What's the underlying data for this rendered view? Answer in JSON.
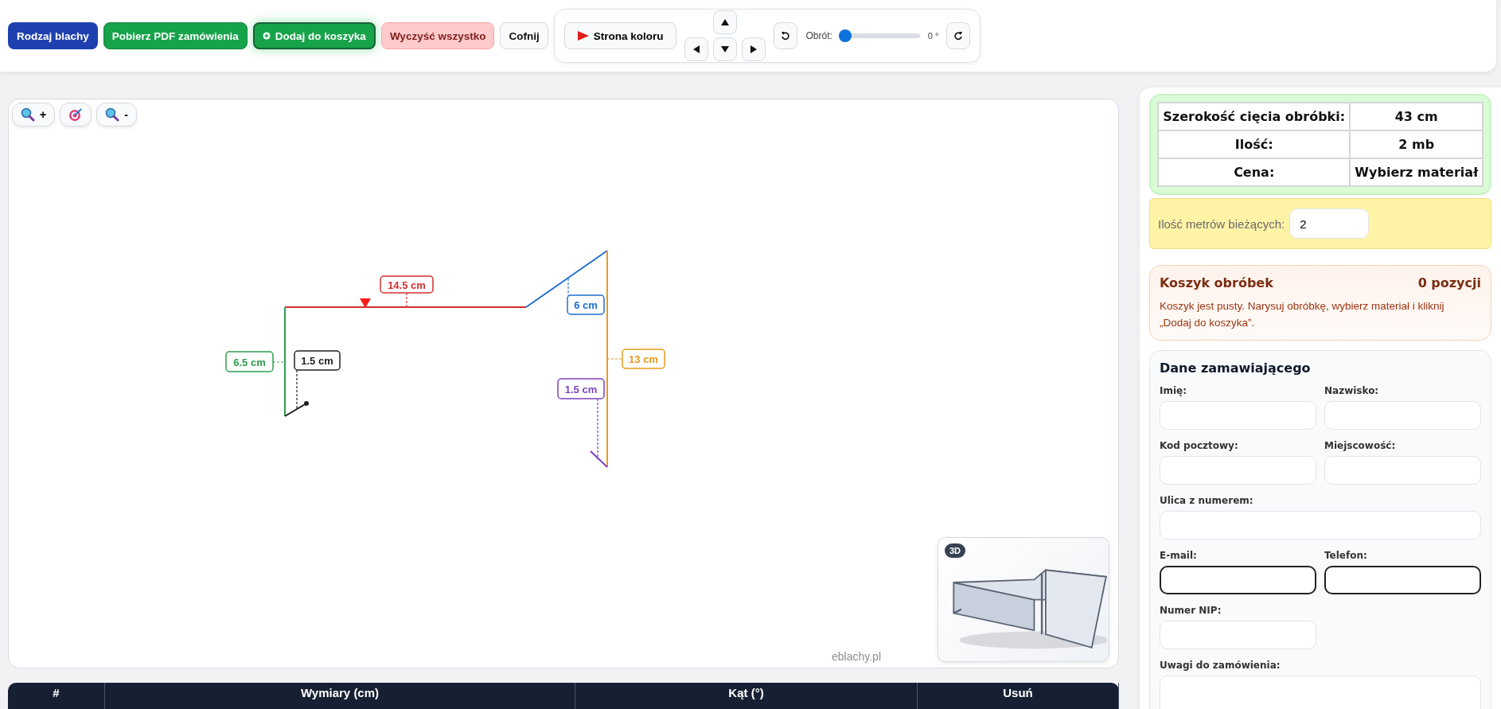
{
  "toolbar": {
    "buttons": [
      {
        "label": "Rodzaj blachy",
        "kind": "primary"
      },
      {
        "label": "Pobierz PDF zamówienia",
        "kind": "success"
      },
      {
        "label": "Dodaj do koszyka",
        "kind": "cart"
      },
      {
        "label": "Wyczyść wszystko",
        "kind": "danger"
      },
      {
        "label": "Cofnij",
        "kind": "light"
      }
    ],
    "side_button": {
      "label": "Strona koloru"
    },
    "rotation": {
      "label": "Obrót:",
      "level": 0,
      "reading": "0 °"
    }
  },
  "canvas": {
    "zoom_controls": [
      {
        "kind": "zoom-in",
        "label": "+"
      },
      {
        "kind": "center"
      },
      {
        "kind": "zoom-out",
        "label": "-"
      }
    ],
    "segments": [
      {
        "label": "14.5 cm",
        "color": "#d32f2f"
      },
      {
        "label": "6 cm",
        "color": "#1f6fd1"
      },
      {
        "label": "6.5 cm",
        "color": "#2e9e4f"
      },
      {
        "label": "1.5 cm",
        "color": "#222222"
      },
      {
        "label": "13 cm",
        "color": "#e89a1c"
      },
      {
        "label": "1.5 cm",
        "color": "#7e3fbf"
      }
    ],
    "site_label": "eblachy.pl",
    "preview": {
      "badge": "3D"
    }
  },
  "table": {
    "columns": [
      "#",
      "Wymiary (cm)",
      "Kąt (°)",
      "Usuń"
    ]
  },
  "summary": {
    "rows": [
      {
        "label": "Szerokość cięcia obróbki:",
        "value": "43 cm"
      },
      {
        "label": "Ilość:",
        "value": "2 mb"
      },
      {
        "label": "Cena:",
        "value": "Wybierz materiał"
      }
    ]
  },
  "meters": {
    "label": "Ilość metrów bieżących:",
    "value": "2"
  },
  "cart": {
    "title": "Koszyk obróbek",
    "count": "0 pozycji",
    "message": "Koszyk jest pusty. Narysuj obróbkę, wybierz materiał i kliknij „Dodaj do koszyka”."
  },
  "customer": {
    "title": "Dane zamawiającego",
    "fields": [
      {
        "label": "Imię:",
        "kind": "half",
        "highlighted": false
      },
      {
        "label": "Nazwisko:",
        "kind": "half",
        "highlighted": false
      },
      {
        "label": "Kod pocztowy:",
        "kind": "half",
        "highlighted": false
      },
      {
        "label": "Miejscowość:",
        "kind": "half",
        "highlighted": false
      },
      {
        "label": "Ulica z numerem:",
        "kind": "full",
        "highlighted": false
      },
      {
        "label": "E-mail:",
        "kind": "half",
        "highlighted": true
      },
      {
        "label": "Telefon:",
        "kind": "half",
        "highlighted": true
      },
      {
        "label": "Numer NIP:",
        "kind": "half",
        "highlighted": false
      },
      {
        "label": "Uwagi do zamówienia:",
        "kind": "textarea",
        "highlighted": false
      }
    ]
  }
}
